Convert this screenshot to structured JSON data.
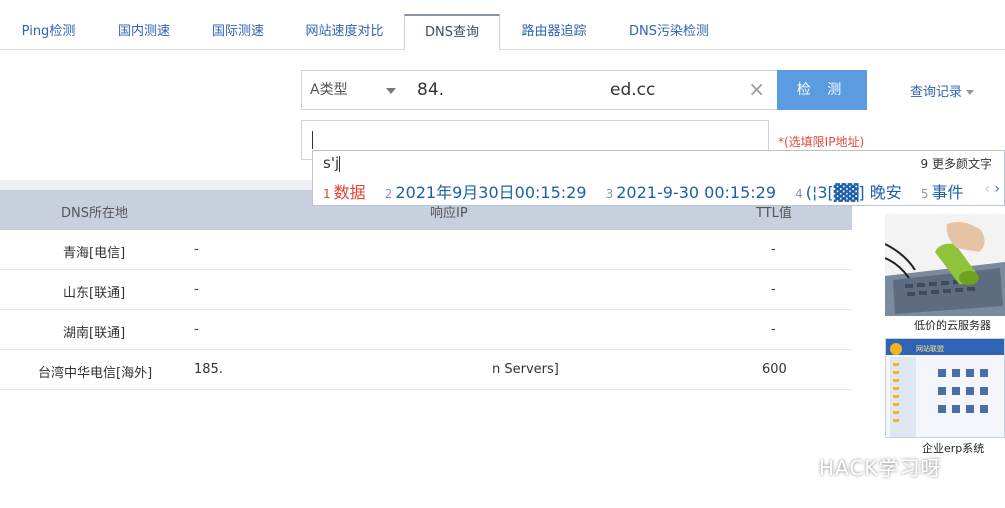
{
  "tabs": [
    {
      "label": "Ping检测"
    },
    {
      "label": "国内测速"
    },
    {
      "label": "国际测速"
    },
    {
      "label": "网站速度对比"
    },
    {
      "label": "DNS查询",
      "active": true
    },
    {
      "label": "路由器追踪"
    },
    {
      "label": "DNS污染检测"
    }
  ],
  "query": {
    "record_type": "A类型",
    "domain_part1": "84.",
    "domain_part2": "ed.cc",
    "submit_label": "检 测",
    "history_label": "查询记录",
    "ip_hint": "*(选填限IP地址)"
  },
  "ime": {
    "composition": "s'j",
    "more_label": "9 更多颜文字",
    "candidates": [
      {
        "num": "1",
        "text": "数据"
      },
      {
        "num": "2",
        "text": "2021年9月30日00:15:29"
      },
      {
        "num": "3",
        "text": "2021-9-30 00:15:29"
      },
      {
        "num": "4",
        "text": "(¦3[▓▓] 晚安"
      },
      {
        "num": "5",
        "text": "事件"
      }
    ]
  },
  "results": {
    "headers": {
      "location": "DNS所在地",
      "ip": "响应IP",
      "ttl": "TTL值"
    },
    "rows": [
      {
        "location": "青海[电信]",
        "ip": "-",
        "ttl": "-"
      },
      {
        "location": "山东[联通]",
        "ip": "-",
        "ttl": "-"
      },
      {
        "location": "湖南[联通]",
        "ip": "-",
        "ttl": "-"
      },
      {
        "location": "台湾中华电信[海外]",
        "ip": "185.",
        "ip_extra": "n Servers]",
        "ttl": "600"
      }
    ]
  },
  "ads": {
    "ad1_caption": "低价的云服务器",
    "ad2_caption": "企业erp系统",
    "ad2_title": "网站联盟"
  },
  "watermark": "HACK学习呀",
  "colors": {
    "accent": "#5b9bdf",
    "link": "#2f63b5",
    "hint": "#e24a3b",
    "table_header": "#c8d0dd"
  }
}
